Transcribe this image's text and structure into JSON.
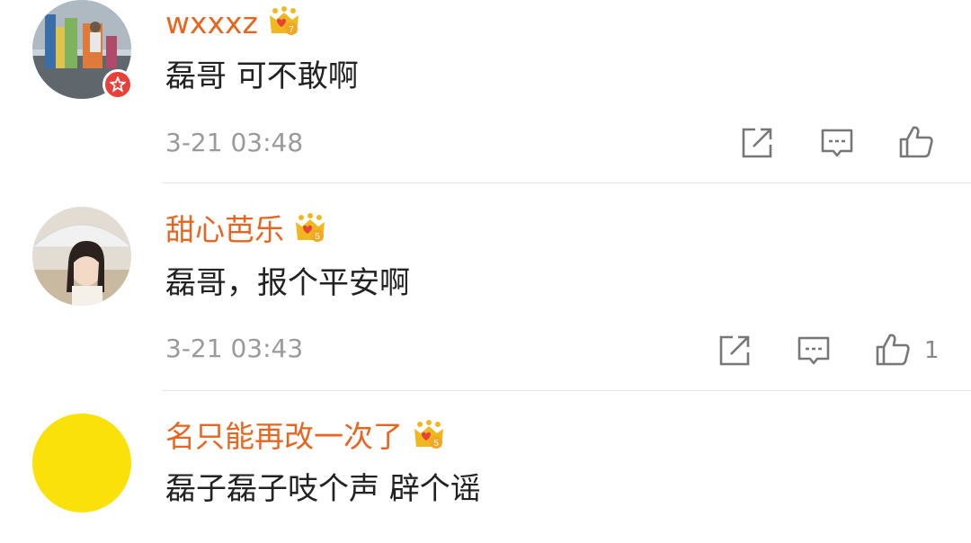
{
  "comments": [
    {
      "username": "wxxxz",
      "vip_level": "7",
      "content": "磊哥 可不敢啊",
      "time": "3-21 03:48",
      "likes": ""
    },
    {
      "username": "甜心芭乐",
      "vip_level": "5",
      "content": "磊哥，报个平安啊",
      "time": "3-21 03:43",
      "likes": "1"
    },
    {
      "username": "名只能再改一次了",
      "vip_level": "5",
      "content": "磊子磊子吱个声 辟个谣",
      "time": "",
      "likes": ""
    }
  ],
  "colors": {
    "username": "#e8651f",
    "content": "#222222",
    "time": "#9a9a9a",
    "badge_red": "#e8413a",
    "crown_gold": "#f0b81e",
    "avatar_yellow": "#fbe10a"
  },
  "icons": {
    "repost": "share-square-icon",
    "comment": "comment-bubble-icon",
    "like": "thumbs-up-icon",
    "crown": "vip-crown-icon",
    "verified": "star-badge-icon"
  }
}
